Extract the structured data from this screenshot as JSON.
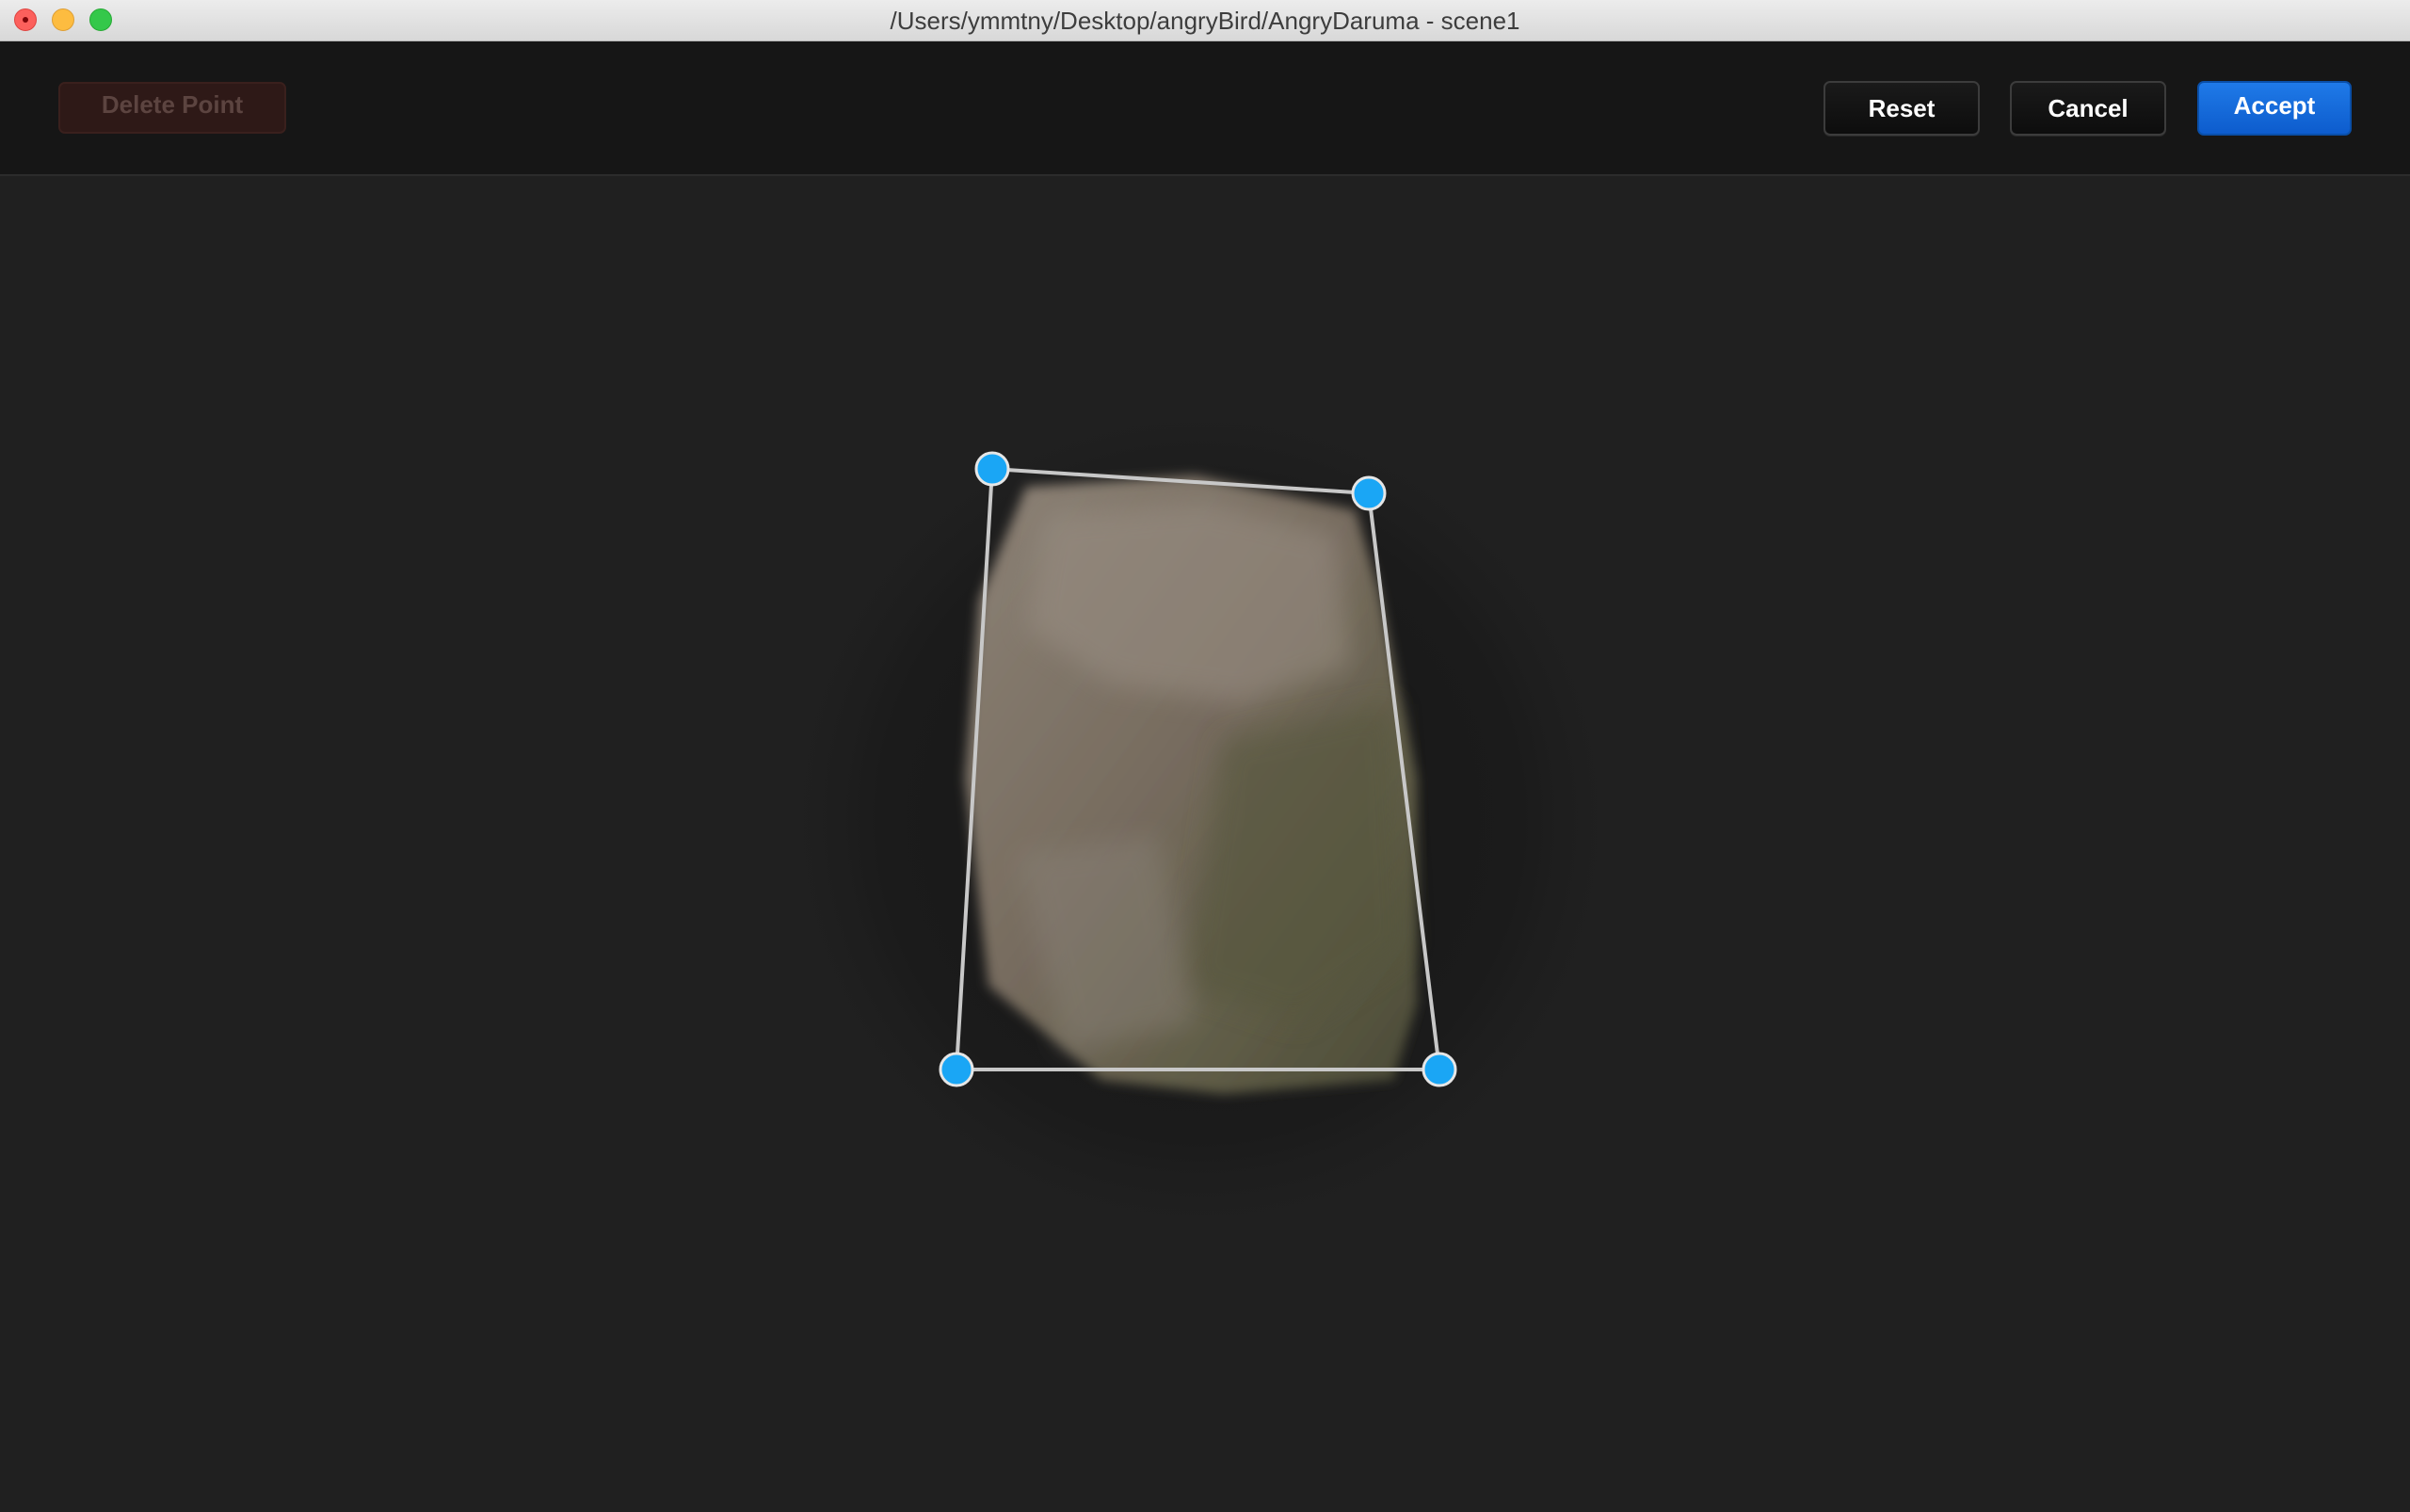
{
  "window": {
    "title": "/Users/ymmtny/Desktop/angryBird/AngryDaruma - scene1"
  },
  "toolbar": {
    "delete_point_label": "Delete Point",
    "reset_label": "Reset",
    "cancel_label": "Cancel",
    "accept_label": "Accept"
  },
  "editor": {
    "image_subject": "rock",
    "handle_count": 4,
    "colors": {
      "handle": "#1aa6f5",
      "outline": "#c8c8c8",
      "accept_button": "#1166dd"
    }
  }
}
